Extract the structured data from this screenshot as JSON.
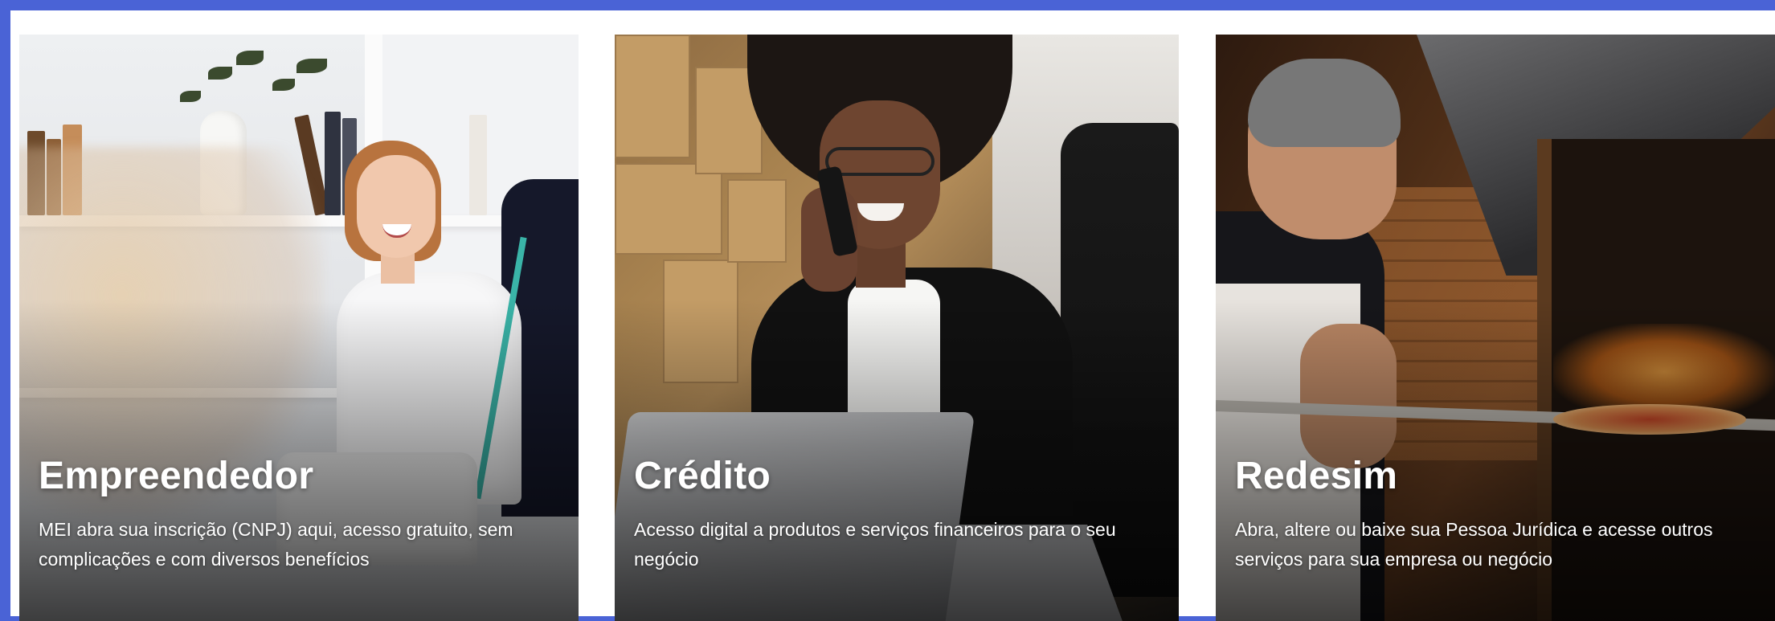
{
  "frame": {
    "border_color": "#4a63d6"
  },
  "cards": [
    {
      "title": "Empreendedor",
      "description": "MEI abra sua inscrição (CNPJ) aqui, acesso gratuito, sem complicações e com diversos benefícios",
      "image": "woman-seamstress-photo"
    },
    {
      "title": "Crédito",
      "description": "Acesso digital a produtos e serviços financeiros para o seu negócio",
      "image": "woman-on-phone-laptop-photo"
    },
    {
      "title": "Redesim",
      "description": "Abra, altere ou baixe sua Pessoa Jurídica e acesse outros serviços para sua empresa ou negócio",
      "image": "pizza-chef-oven-photo"
    }
  ]
}
